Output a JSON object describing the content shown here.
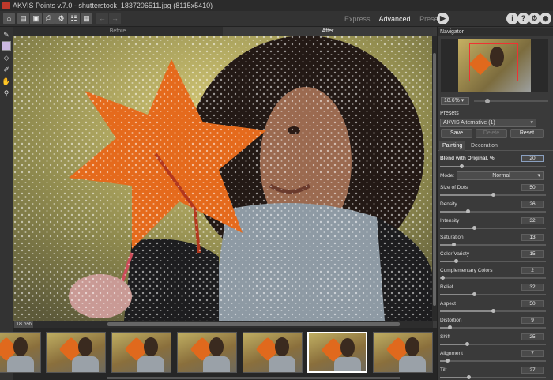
{
  "title": "AKVIS Points v.7.0 - shutterstock_1837206511.jpg (8115x5410)",
  "modes": {
    "express": "Express",
    "advanced": "Advanced",
    "presets": "Presets"
  },
  "canvas": {
    "before": "Before",
    "after": "After",
    "zoom": "18.6%"
  },
  "navigator": {
    "title": "Navigator",
    "zoom": "18.6%"
  },
  "presets": {
    "title": "Presets",
    "selected": "AKVIS Alternative (1)",
    "save": "Save",
    "delete": "Delete",
    "reset": "Reset"
  },
  "tabs": {
    "painting": "Painting",
    "decoration": "Decoration"
  },
  "blend": {
    "label": "Blend with Original, %",
    "value": "20",
    "level": 0.2
  },
  "mode": {
    "label": "Mode:",
    "value": "Normal"
  },
  "params": [
    {
      "label": "Size of Dots",
      "value": "50",
      "level": 0.5
    },
    {
      "label": "Density",
      "value": "26",
      "level": 0.26
    },
    {
      "label": "Intensity",
      "value": "32",
      "level": 0.32
    },
    {
      "label": "Saturation",
      "value": "13",
      "level": 0.13
    },
    {
      "label": "Color Variety",
      "value": "15",
      "level": 0.15
    },
    {
      "label": "Complementary Colors",
      "value": "2",
      "level": 0.02
    },
    {
      "label": "Relief",
      "value": "32",
      "level": 0.32
    },
    {
      "label": "Aspect",
      "value": "50",
      "level": 0.5
    },
    {
      "label": "Distortion",
      "value": "9",
      "level": 0.09
    },
    {
      "label": "Shift",
      "value": "25",
      "level": 0.25
    },
    {
      "label": "Alignment",
      "value": "7",
      "level": 0.07
    },
    {
      "label": "Tilt",
      "value": "27",
      "level": 0.27
    }
  ]
}
